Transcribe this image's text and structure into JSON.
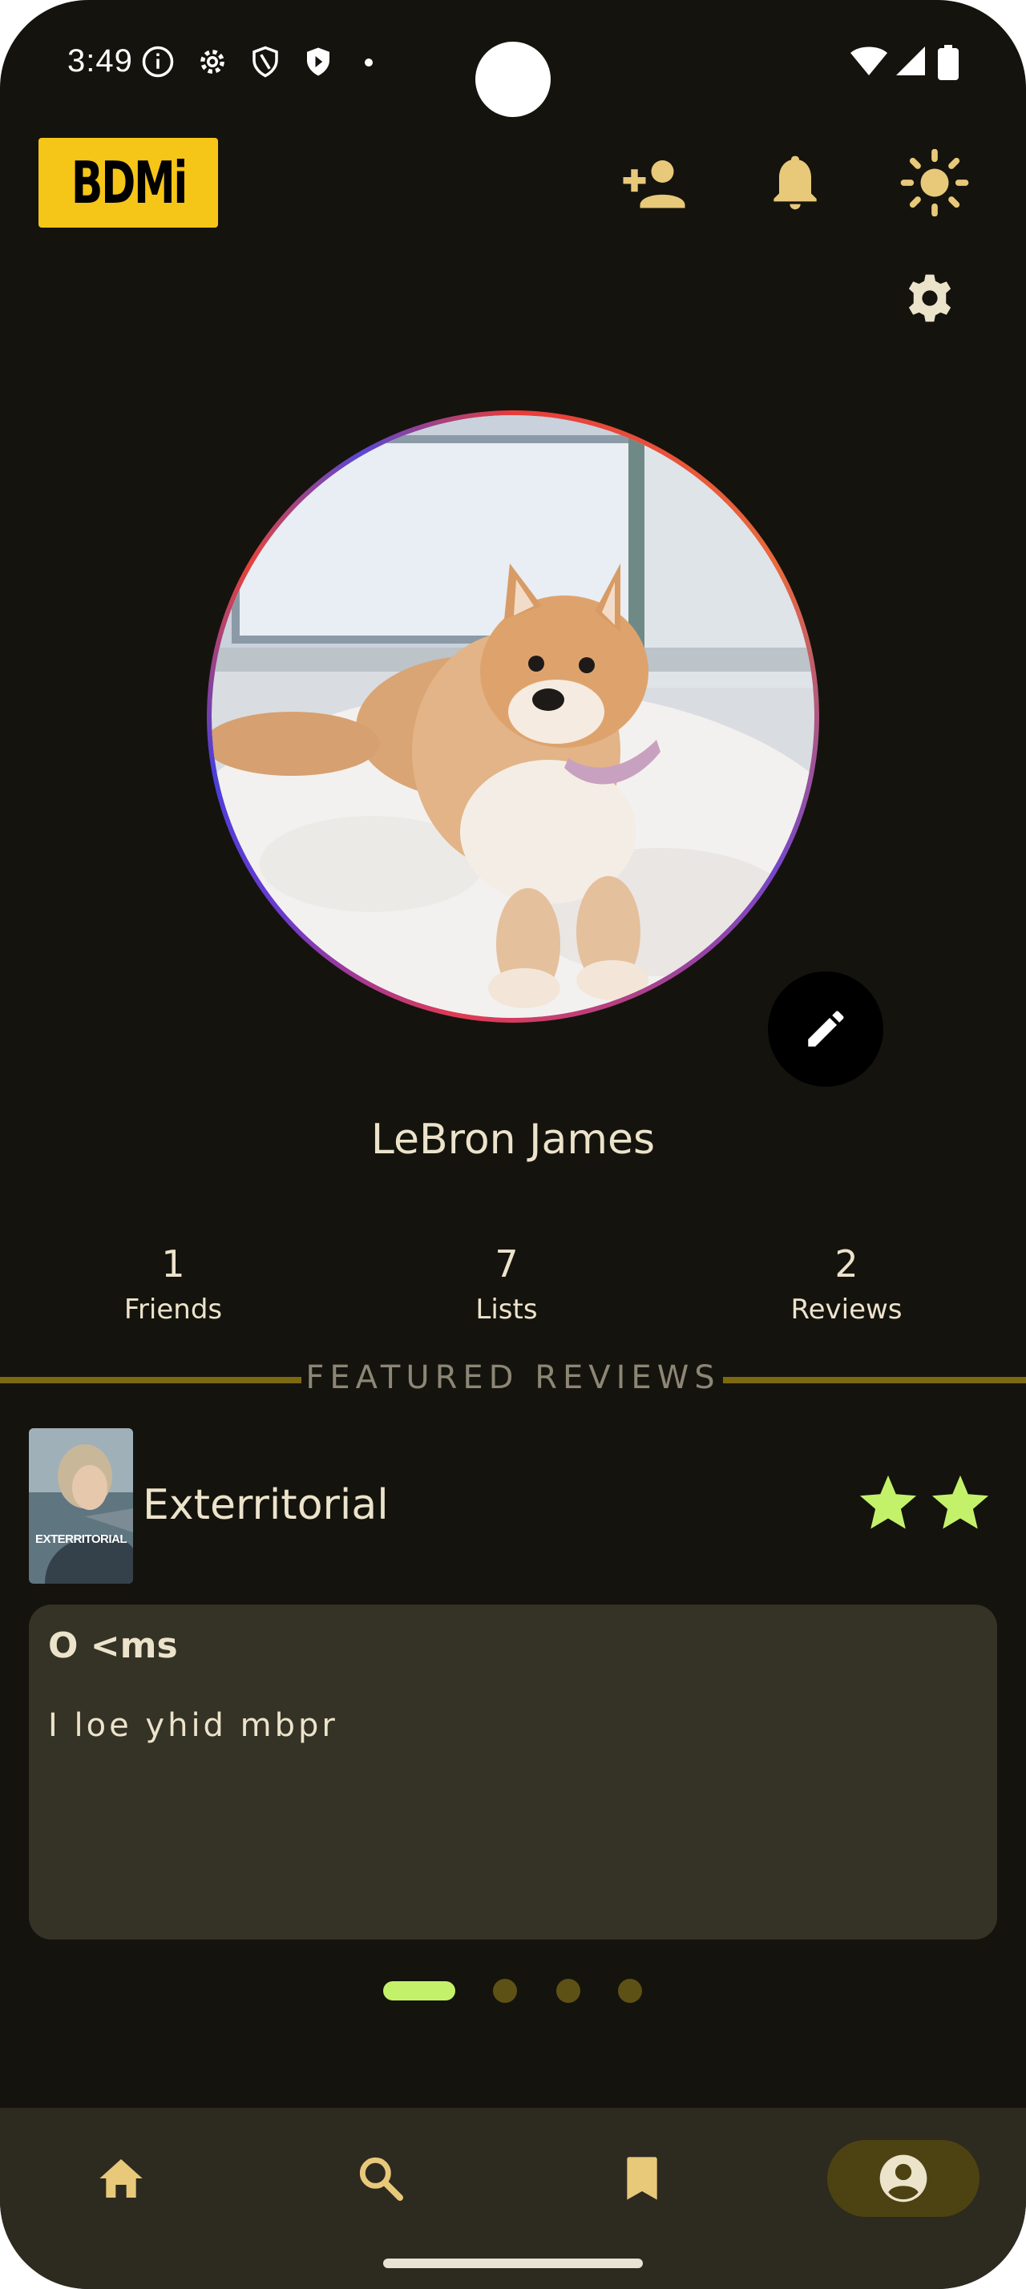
{
  "status_bar": {
    "time": "3:49"
  },
  "app": {
    "logo_text": "BDMi"
  },
  "top_bar": {
    "icons": [
      "person-add-icon",
      "bell-icon",
      "sun-icon",
      "gear-icon"
    ]
  },
  "profile": {
    "name": "LeBron James",
    "stats": [
      {
        "value": "1",
        "label": "Friends"
      },
      {
        "value": "7",
        "label": "Lists"
      },
      {
        "value": "2",
        "label": "Reviews"
      }
    ]
  },
  "featured": {
    "heading": "FEATURED REVIEWS",
    "review": {
      "movie_title": "Exterritorial",
      "poster_text": "EXTERRITORIAL",
      "rating": 2,
      "title": "O <ms",
      "body": "I loe yhid mbpr"
    },
    "pager": {
      "count": 4,
      "active_index": 0
    }
  },
  "bottom_nav": {
    "items": [
      "home-icon",
      "search-icon",
      "bookmark-icon",
      "account-icon"
    ],
    "active_index": 3
  },
  "colors": {
    "background": "#15130d",
    "accent": "#f5c518",
    "icon": "#e8c97a",
    "star": "#c3f26a",
    "card": "#353226",
    "nav": "#2d2a20"
  }
}
